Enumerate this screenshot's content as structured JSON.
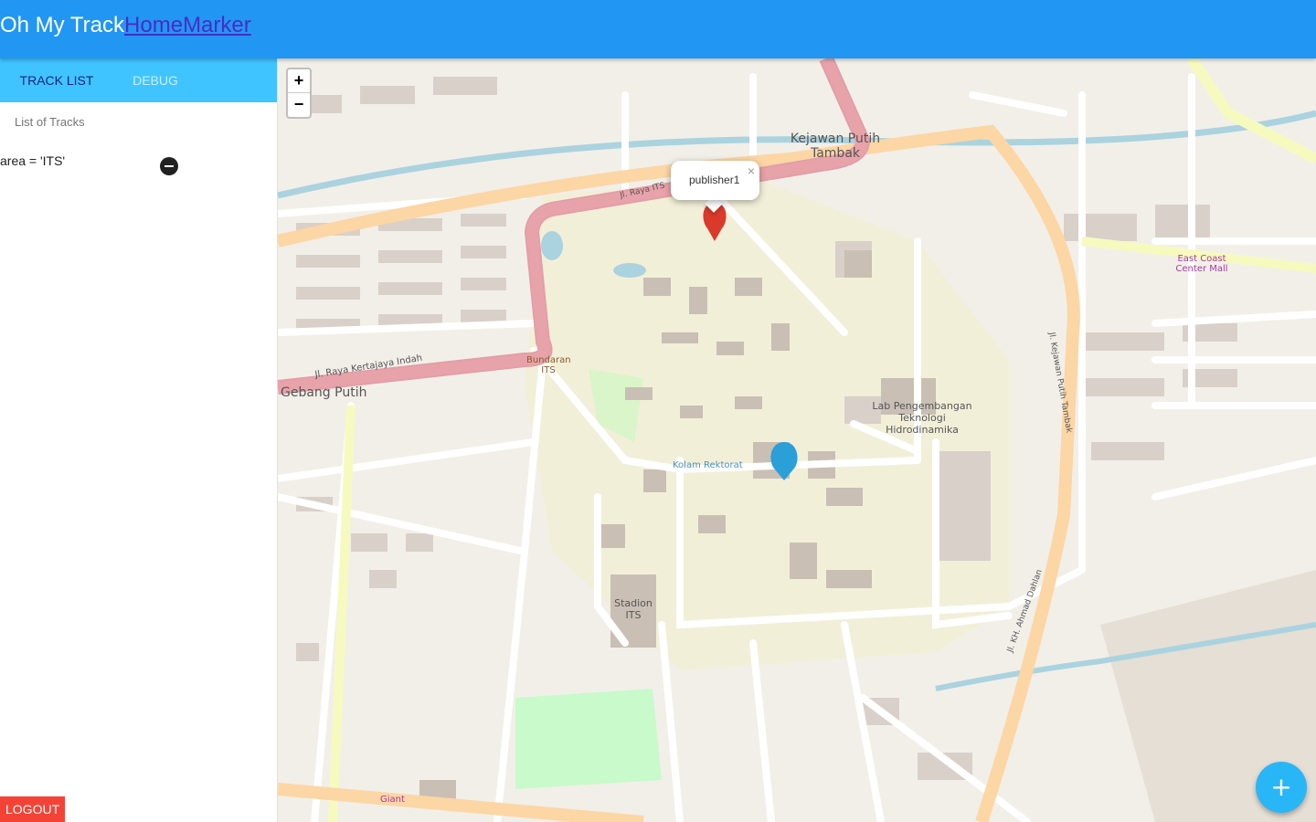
{
  "header": {
    "title": "Oh My Track",
    "nav": [
      "Home",
      "Marker"
    ]
  },
  "sidebar": {
    "tabs": [
      {
        "label": "TRACK LIST",
        "active": true
      },
      {
        "label": "DEBUG",
        "active": false
      }
    ],
    "subheader": "List of Tracks",
    "tracks": [
      {
        "label": "area = 'ITS'"
      }
    ],
    "logout_label": "LOGOUT"
  },
  "map": {
    "zoom_in": "+",
    "zoom_out": "−",
    "popup": {
      "text": "publisher1",
      "close": "×"
    },
    "labels": {
      "kejawan": "Kejawan Putih Tambak",
      "gebang": "Gebang Putih",
      "bundaran": "Bundaran ITS",
      "kolam": "Kolam Rektorat",
      "lab": "Lab Pengembangan Teknologi Hidrodinamika",
      "stadion": "Stadion ITS",
      "eastcoast": "East Coast Center Mall",
      "giant": "Giant",
      "road_raya_its": "Jl. Raya ITS",
      "road_kertajaya": "Jl. Raya Kertajaya Indah",
      "road_kejawan": "Jl. Kejawan Putih Tambak",
      "road_dahlan": "Jl. KH. Ahmad Dahlan"
    }
  },
  "fab_label": "+",
  "colors": {
    "appbar": "#2196f3",
    "tabs": "#40c4ff",
    "logout": "#f44336",
    "fab": "#29b6f6"
  }
}
